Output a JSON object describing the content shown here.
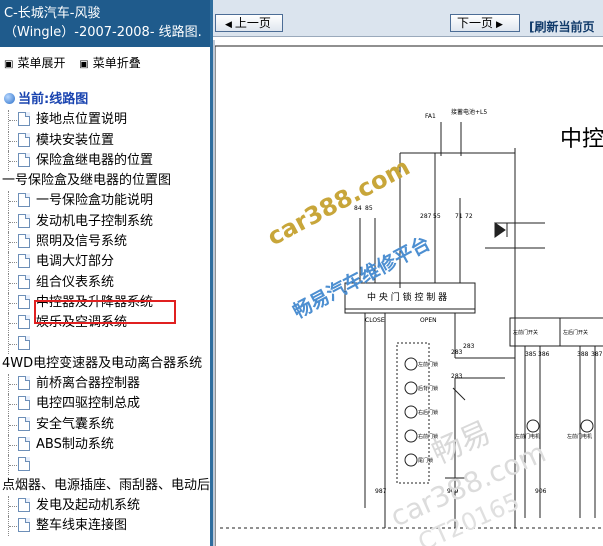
{
  "sidebar": {
    "title_line1": "C-长城汽车-风骏",
    "title_line2": "（Wingle）-2007-2008- 线路图.",
    "expand_label": "菜单展开",
    "collapse_label": "菜单折叠",
    "root_label": "当前:线路图",
    "items": [
      {
        "type": "leaf",
        "label": "接地点位置说明"
      },
      {
        "type": "leaf",
        "label": "模块安装位置"
      },
      {
        "type": "leaf",
        "label": "保险盒继电器的位置"
      },
      {
        "type": "group",
        "label": "一号保险盒及继电器的位置图"
      },
      {
        "type": "leaf",
        "label": "一号保险盒功能说明"
      },
      {
        "type": "leaf",
        "label": "发动机电子控制系统"
      },
      {
        "type": "leaf",
        "label": "照明及信号系统"
      },
      {
        "type": "leaf",
        "label": "电调大灯部分"
      },
      {
        "type": "leaf",
        "label": "组合仪表系统"
      },
      {
        "type": "leaf",
        "label": "中控器及升降器系统"
      },
      {
        "type": "leaf",
        "label": "娱乐及空调系统"
      },
      {
        "type": "leaf",
        "label": ""
      },
      {
        "type": "group",
        "label": "4WD电控变速器及电动离合器系统"
      },
      {
        "type": "leaf",
        "label": "前桥离合器控制器"
      },
      {
        "type": "leaf",
        "label": "电控四驱控制总成"
      },
      {
        "type": "leaf",
        "label": "安全气囊系统"
      },
      {
        "type": "leaf",
        "label": "ABS制动系统"
      },
      {
        "type": "leaf",
        "label": ""
      },
      {
        "type": "group",
        "label": "点烟器、电源插座、雨刮器、电动后"
      },
      {
        "type": "leaf",
        "label": "发电及起动机系统"
      },
      {
        "type": "leaf",
        "label": "整车线束连接图"
      }
    ]
  },
  "toolbar": {
    "prev_label": "上一页",
    "next_label": "下一页",
    "refresh_label": "[刷新当前页"
  },
  "diagram": {
    "heading": "中控",
    "module_label": "中 央 门 锁 控 制 器",
    "close_label": "CLOSE",
    "open_label": "OPEN",
    "fuse_label": "FA1",
    "top_note": "接蓄电池+L5",
    "motor_labels": [
      "左前门锁",
      "后背门锁",
      "右后门锁",
      "右前门锁",
      "尾门锁",
      "左前门电机",
      "左前门电机"
    ],
    "switch_labels": [
      "左前门开关",
      "左后门开关"
    ],
    "wire_numbers": [
      "84",
      "85",
      "287",
      "55",
      "71",
      "72",
      "283",
      "283",
      "283",
      "987",
      "909",
      "906",
      "385",
      "386",
      "388",
      "387"
    ],
    "watermarks": [
      "car388.com",
      "畅易汽车维修平台",
      "畅易",
      "car388.com",
      "CT20165"
    ]
  }
}
